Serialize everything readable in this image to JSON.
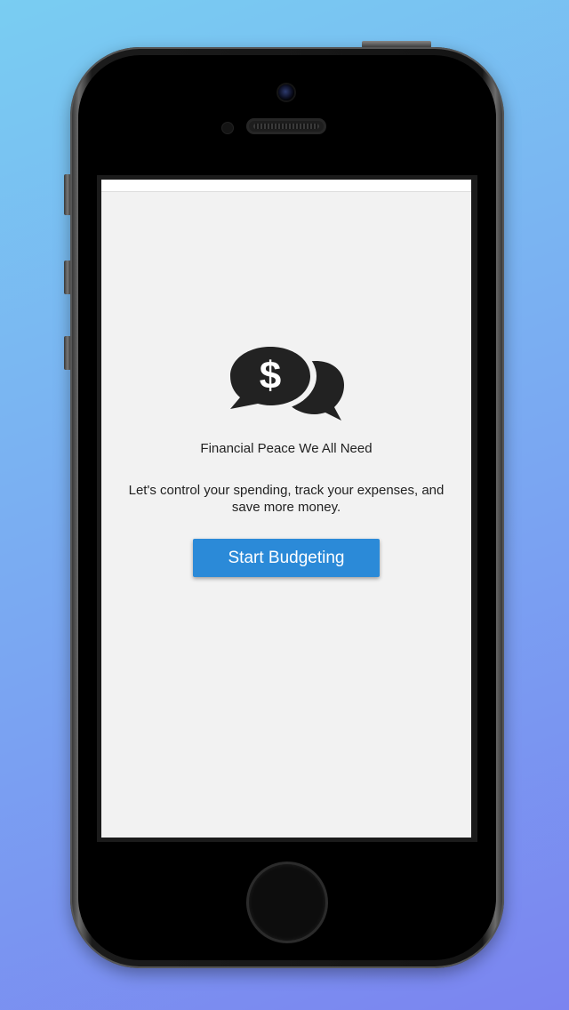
{
  "app": {
    "logo_icon": "dollar-chat-bubbles-icon",
    "tagline": "Financial Peace We All Need",
    "description": "Let's control your spending, track your expenses, and save more money.",
    "start_button_label": "Start Budgeting"
  },
  "colors": {
    "background_top": "#79cdf2",
    "background_bottom": "#7b84f0",
    "screen_bg": "#f2f2f2",
    "accent_button": "#2b8ad8",
    "icon": "#222222"
  }
}
